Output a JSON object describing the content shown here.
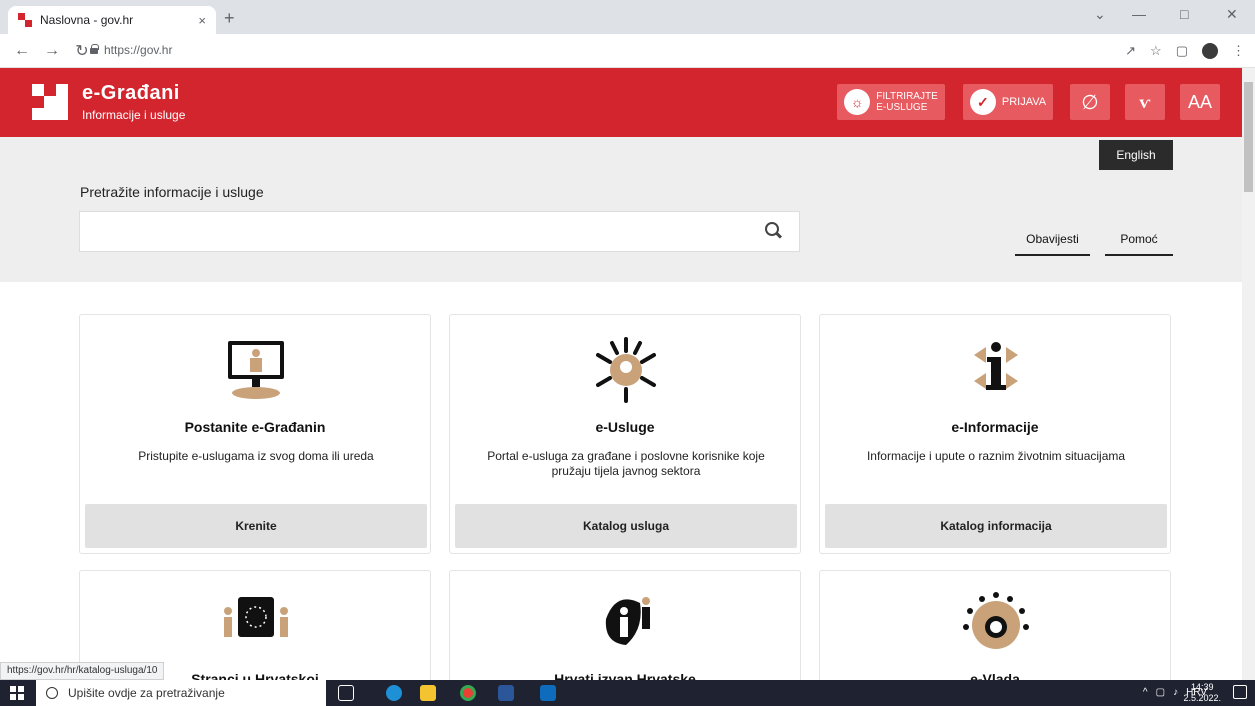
{
  "browser": {
    "tab_title": "Naslovna - gov.hr",
    "tab_close": "×",
    "new_tab": "+",
    "url": "https://gov.hr",
    "status_url": "https://gov.hr/hr/katalog-usluga/10",
    "icons": [
      "back-icon",
      "forward-icon",
      "reload-icon",
      "lock-icon",
      "share-icon",
      "star-icon",
      "sidebar-icon",
      "profile-icon",
      "menu-icon"
    ]
  },
  "header": {
    "title": "e-Građani",
    "subtitle": "Informacije i usluge",
    "filter_label_1": "FILTRIRAJTE",
    "filter_label_2": "E-USLUGE",
    "login_label": "PRIJAVA",
    "font_size_label": "AA",
    "language_tooltip": "English",
    "brand_color": "#d3252e"
  },
  "search": {
    "label": "Pretražite informacije i usluge",
    "value": "",
    "placeholder": ""
  },
  "side_links": {
    "notifications": "Obavijesti",
    "help": "Pomoć"
  },
  "cards": [
    {
      "title": "Postanite e-Građanin",
      "description": "Pristupite e-uslugama iz svog doma ili ureda",
      "button": "Krenite",
      "icon": "computer-person-icon"
    },
    {
      "title": "e-Usluge",
      "description": "Portal e-usluga za građane i poslovne korisnike koje pružaju tijela javnog sektora",
      "button": "Katalog usluga",
      "icon": "services-network-icon"
    },
    {
      "title": "e-Informacije",
      "description": "Informacije i upute o raznim životnim situacijama",
      "button": "Katalog informacija",
      "icon": "information-icon"
    }
  ],
  "lower_cards": [
    {
      "title": "Stranci u Hrvatskoj",
      "icon": "eu-flag-people-icon"
    },
    {
      "title": "Hrvati izvan Hrvatske",
      "icon": "people-silhouette-icon"
    },
    {
      "title": "e-Vlada",
      "icon": "government-circle-icon"
    }
  ],
  "taskbar": {
    "search_placeholder": "Upišite ovdje za pretraživanje",
    "language": "HRV",
    "time": "14:39",
    "date": "2.5.2022."
  }
}
